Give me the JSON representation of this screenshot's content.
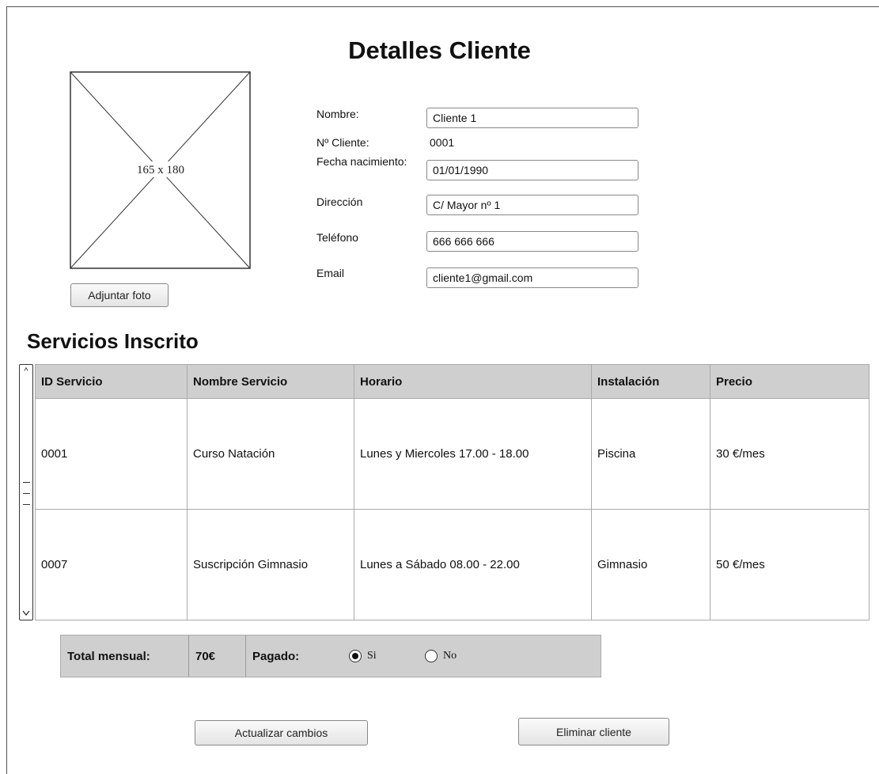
{
  "header": {
    "title": "Detalles Cliente"
  },
  "photo": {
    "caption": "165 x 180",
    "attach_label": "Adjuntar foto"
  },
  "form": {
    "nombre_label": "Nombre:",
    "nombre_value": "Cliente 1",
    "numero_label": "Nº Cliente:",
    "numero_value": "0001",
    "fecha_label": "Fecha nacimiento:",
    "fecha_value": "01/01/1990",
    "direccion_label": "Dirección",
    "direccion_value": "C/ Mayor nº 1",
    "telefono_label": "Teléfono",
    "telefono_value": "666 666 666",
    "email_label": "Email",
    "email_value": "cliente1@gmail.com"
  },
  "services": {
    "title": "Servicios Inscrito",
    "columns": [
      "ID Servicio",
      "Nombre Servicio",
      "Horario",
      "Instalación",
      "Precio"
    ],
    "rows": [
      [
        "0001",
        "Curso Natación",
        "Lunes y Miercoles 17.00 - 18.00",
        "Piscina",
        "30 €/mes"
      ],
      [
        "0007",
        "Suscripción Gimnasio",
        "Lunes a Sábado 08.00 - 22.00",
        "Gimnasio",
        "50 €/mes"
      ]
    ]
  },
  "totals": {
    "label": "Total mensual:",
    "value": "70€",
    "paid_label": "Pagado:",
    "options": [
      {
        "label": "Si",
        "selected": true
      },
      {
        "label": "No",
        "selected": false
      }
    ]
  },
  "actions": {
    "update_label": "Actualizar cambios",
    "delete_label": "Eliminar cliente"
  },
  "icons": {
    "scroll_up": "chevron-up-icon",
    "scroll_down": "chevron-down-icon"
  }
}
